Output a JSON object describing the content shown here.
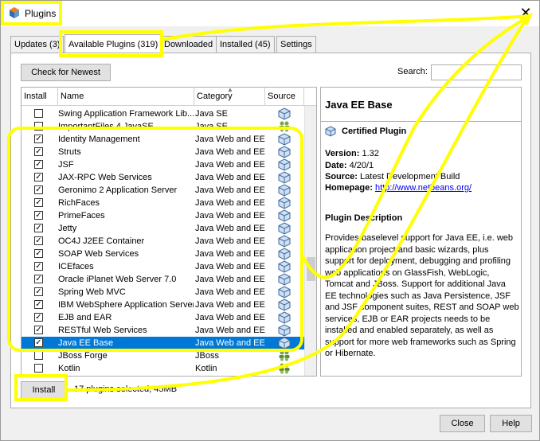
{
  "window": {
    "title": "Plugins"
  },
  "tabs": [
    {
      "label": "Updates (3)",
      "active": false
    },
    {
      "label": "Available Plugins (319)",
      "active": true
    },
    {
      "label": "Downloaded",
      "active": false
    },
    {
      "label": "Installed (45)",
      "active": false
    },
    {
      "label": "Settings",
      "active": false
    }
  ],
  "toolbar": {
    "check_label": "Check for Newest",
    "search_label": "Search:",
    "search_value": ""
  },
  "table": {
    "headers": {
      "install": "Install",
      "name": "Name",
      "category": "Category",
      "source": "Source"
    },
    "rows": [
      {
        "checked": false,
        "name": "Swing Application Framework Lib...",
        "category": "Java SE",
        "source": "cube-icon"
      },
      {
        "checked": false,
        "name": "ImportantFiles 4 JavaSE",
        "category": "Java SE",
        "source": "community-icon"
      },
      {
        "checked": true,
        "name": "Identity Management",
        "category": "Java Web and EE",
        "source": "cube-icon"
      },
      {
        "checked": true,
        "name": "Struts",
        "category": "Java Web and EE",
        "source": "cube-icon"
      },
      {
        "checked": true,
        "name": "JSF",
        "category": "Java Web and EE",
        "source": "cube-icon"
      },
      {
        "checked": true,
        "name": "JAX-RPC Web Services",
        "category": "Java Web and EE",
        "source": "cube-icon"
      },
      {
        "checked": true,
        "name": "Geronimo 2 Application Server",
        "category": "Java Web and EE",
        "source": "cube-icon"
      },
      {
        "checked": true,
        "name": "RichFaces",
        "category": "Java Web and EE",
        "source": "cube-icon"
      },
      {
        "checked": true,
        "name": "PrimeFaces",
        "category": "Java Web and EE",
        "source": "cube-icon"
      },
      {
        "checked": true,
        "name": "Jetty",
        "category": "Java Web and EE",
        "source": "cube-icon"
      },
      {
        "checked": true,
        "name": "OC4J J2EE Container",
        "category": "Java Web and EE",
        "source": "cube-icon"
      },
      {
        "checked": true,
        "name": "SOAP Web Services",
        "category": "Java Web and EE",
        "source": "cube-icon"
      },
      {
        "checked": true,
        "name": "ICEfaces",
        "category": "Java Web and EE",
        "source": "cube-icon"
      },
      {
        "checked": true,
        "name": "Oracle iPlanet Web Server 7.0",
        "category": "Java Web and EE",
        "source": "cube-icon"
      },
      {
        "checked": true,
        "name": "Spring Web MVC",
        "category": "Java Web and EE",
        "source": "cube-icon"
      },
      {
        "checked": true,
        "name": "IBM WebSphere Application Server",
        "category": "Java Web and EE",
        "source": "cube-icon"
      },
      {
        "checked": true,
        "name": "EJB and EAR",
        "category": "Java Web and EE",
        "source": "cube-icon"
      },
      {
        "checked": true,
        "name": "RESTful Web Services",
        "category": "Java Web and EE",
        "source": "cube-icon"
      },
      {
        "checked": true,
        "name": "Java EE Base",
        "category": "Java Web and EE",
        "source": "cube-icon",
        "selected": true
      },
      {
        "checked": false,
        "name": "JBoss Forge",
        "category": "JBoss",
        "source": "community-icon"
      },
      {
        "checked": false,
        "name": "Kotlin",
        "category": "Kotlin",
        "source": "community-icon"
      }
    ]
  },
  "detail": {
    "title": "Java EE Base",
    "certified": "Certified Plugin",
    "version_label": "Version:",
    "version_value": "1.32",
    "date_label": "Date:",
    "date_value": "4/20/1",
    "source_label": "Source:",
    "source_value": "Latest Development Build",
    "homepage_label": "Homepage:",
    "homepage_value": "http://www.netbeans.org/",
    "description_heading": "Plugin Description",
    "description": "Provides baselevel support for Java EE, i.e. web application project and basic wizards, plus support for deployment, debugging and profiling web applications on GlassFish, WebLogic, Tomcat and JBoss. Support for additional Java EE technologies such as Java Persistence, JSF and JSF component suites, REST and SOAP web services, EJB or EAR projects needs to be installed and enabled separately, as well as support for more web frameworks such as Spring or Hibernate."
  },
  "footer": {
    "install_label": "Install",
    "status": "17 plugins selected, 45MB",
    "close_label": "Close",
    "help_label": "Help"
  },
  "colors": {
    "highlight": "#ffff00",
    "selection": "#0078d7"
  }
}
